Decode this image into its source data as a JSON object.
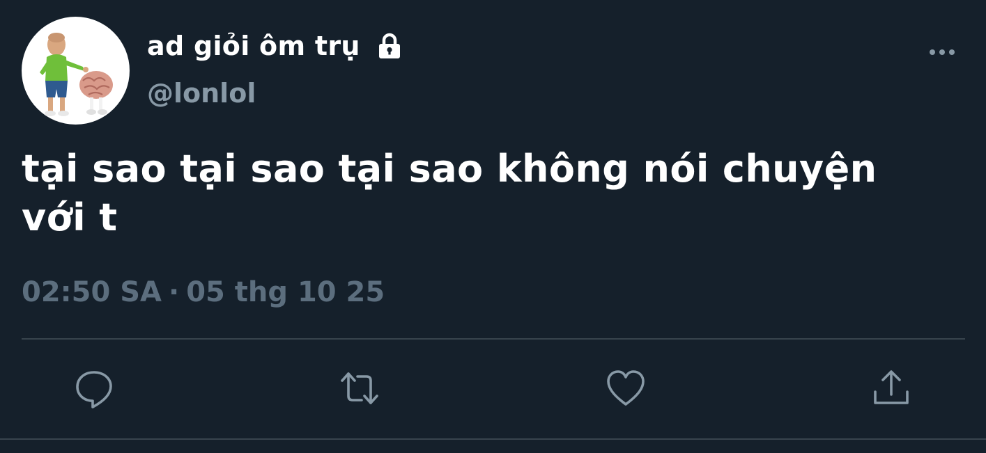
{
  "user": {
    "display_name": "ad giỏi ôm trụ",
    "handle": "@lonlol",
    "protected": true,
    "avatar_icon": "cartoon-man-carrying-brain-avatar"
  },
  "tweet": {
    "text_line1": "tại sao tại sao tại sao không nói chuyện",
    "text_line2": "với t",
    "time": "02:50 SA",
    "separator": "·",
    "date": "05 thg 10 25"
  },
  "actions": [
    {
      "name": "reply",
      "icon": "speech-bubble-icon"
    },
    {
      "name": "retweet",
      "icon": "retweet-arrows-icon"
    },
    {
      "name": "like",
      "icon": "heart-icon"
    },
    {
      "name": "share",
      "icon": "share-upload-icon"
    }
  ],
  "more_icon": "more-dots-icon",
  "colors": {
    "background": "#15202b",
    "text": "#ffffff",
    "secondary_text": "#8899a6",
    "timestamp": "#5c6e7e",
    "divider": "#38444d",
    "icon": "#8899a6"
  }
}
